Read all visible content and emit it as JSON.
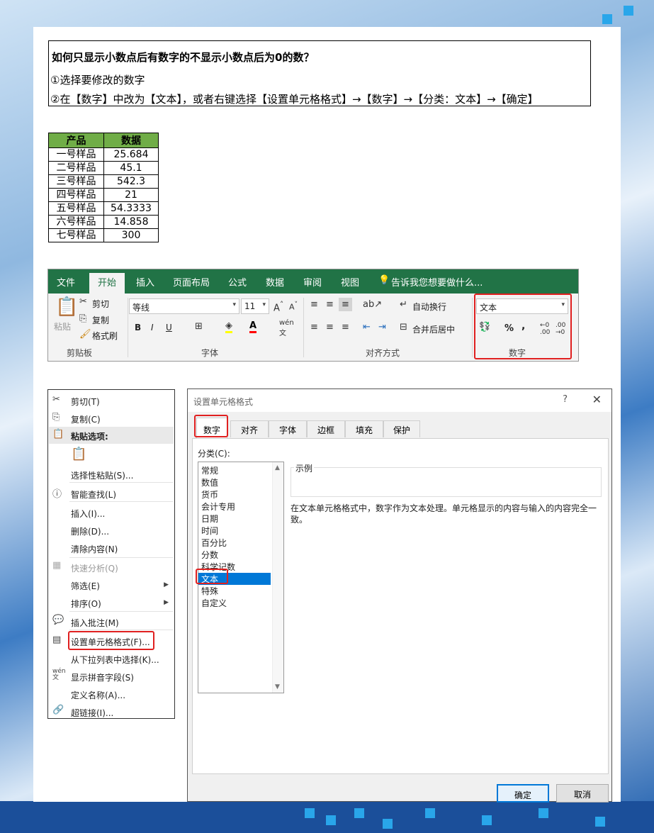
{
  "title_box": {
    "heading": "如何只显示小数点后有数字的不显示小数点后为0的数？",
    "step1": "①选择要修改的数字",
    "step2": "②在【数字】中改为【文本】，或者右键选择【设置单元格格式】→【数字】→【分类：文本】→【确定】"
  },
  "table": {
    "headers": [
      "产品",
      "数据"
    ],
    "rows": [
      [
        "一号样品",
        "25.684"
      ],
      [
        "二号样品",
        "45.1"
      ],
      [
        "三号样品",
        "542.3"
      ],
      [
        "四号样品",
        "21"
      ],
      [
        "五号样品",
        "54.3333"
      ],
      [
        "六号样品",
        "14.858"
      ],
      [
        "七号样品",
        "300"
      ]
    ]
  },
  "ribbon": {
    "tabs": [
      "文件",
      "开始",
      "插入",
      "页面布局",
      "公式",
      "数据",
      "审阅",
      "视图"
    ],
    "tellme": "告诉我您想要做什么...",
    "clipboard": {
      "paste": "粘贴",
      "cut": "剪切",
      "copy": "复制",
      "format_painter": "格式刷",
      "label": "剪贴板"
    },
    "font": {
      "name": "等线",
      "size": "11",
      "bold": "B",
      "italic": "I",
      "underline": "U",
      "label": "字体"
    },
    "align": {
      "wrap": "自动换行",
      "merge": "合并后居中",
      "label": "对齐方式"
    },
    "number": {
      "format": "文本",
      "percent": "%",
      "comma": ",",
      "label": "数字"
    }
  },
  "context_menu": {
    "items": [
      "剪切(T)",
      "复制(C)",
      "粘贴选项:",
      "选择性粘贴(S)...",
      "智能查找(L)",
      "插入(I)...",
      "删除(D)...",
      "清除内容(N)",
      "快速分析(Q)",
      "筛选(E)",
      "排序(O)",
      "插入批注(M)",
      "设置单元格格式(F)...",
      "从下拉列表中选择(K)...",
      "显示拼音字段(S)",
      "定义名称(A)...",
      "超链接(I)..."
    ]
  },
  "dialog": {
    "title": "设置单元格格式",
    "help": "?",
    "close": "✕",
    "tabs": [
      "数字",
      "对齐",
      "字体",
      "边框",
      "填充",
      "保护"
    ],
    "category_label": "分类(C):",
    "categories": [
      "常规",
      "数值",
      "货币",
      "会计专用",
      "日期",
      "时间",
      "百分比",
      "分数",
      "科学记数",
      "文本",
      "特殊",
      "自定义"
    ],
    "selected_category": "文本",
    "example_label": "示例",
    "description": "在文本单元格格式中，数字作为文本处理。单元格显示的内容与输入的内容完全一致。",
    "ok": "确定",
    "cancel": "取消"
  },
  "colors": {
    "excel_green": "#217346",
    "header_green": "#70ad47",
    "highlight_red": "#e02020",
    "selection_blue": "#0078d7"
  }
}
